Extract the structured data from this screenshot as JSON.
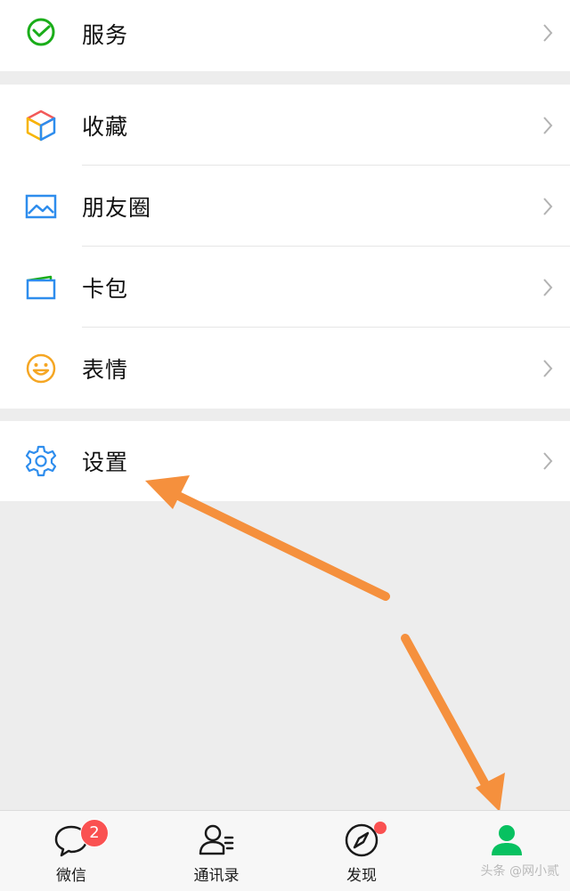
{
  "menu": {
    "group1": [
      {
        "label": "服务",
        "icon": "service-wallet-icon"
      }
    ],
    "group2": [
      {
        "label": "收藏",
        "icon": "favorites-cube-icon"
      },
      {
        "label": "朋友圈",
        "icon": "moments-picture-icon"
      },
      {
        "label": "卡包",
        "icon": "card-wallet-icon"
      },
      {
        "label": "表情",
        "icon": "sticker-smiley-icon"
      }
    ],
    "group3": [
      {
        "label": "设置",
        "icon": "settings-gear-icon"
      }
    ]
  },
  "tabbar": {
    "tabs": [
      {
        "label": "微信",
        "icon": "chat-bubble-icon",
        "badge": "2"
      },
      {
        "label": "通讯录",
        "icon": "contacts-icon"
      },
      {
        "label": "发现",
        "icon": "compass-icon",
        "dot": true
      },
      {
        "label": "",
        "icon": "me-person-icon",
        "active": true
      }
    ]
  },
  "watermark": "头条 @网小贰",
  "colors": {
    "active_green": "#07c160",
    "badge_red": "#fa5151",
    "annotation_arrow": "#f5903d"
  }
}
